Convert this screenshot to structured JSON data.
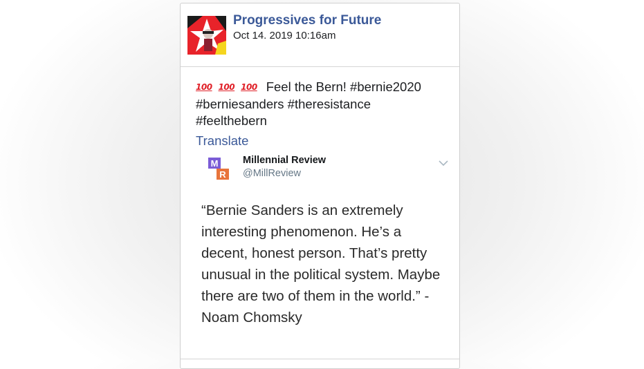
{
  "post": {
    "page_name": "Progressives for Future",
    "timestamp": "Oct 14. 2019 10:16am",
    "emoji_glyph": "100",
    "emoji_icon": "hundred-points-emoji",
    "text_line1": "Feel the Bern! #bernie2020",
    "text_line2": "#berniesanders #theresistance",
    "text_line3": "#feelthebern",
    "translate_label": "Translate"
  },
  "embedded_tweet": {
    "author": "Millennial Review",
    "handle": "@MillReview",
    "logo_letters": [
      "M",
      "R"
    ],
    "quote": "“Bernie Sanders is an extremely interesting phenomenon. He’s a decent, honest person. That’s pretty unusual in the political system. Maybe there are two of them in the world.” - Noam Chomsky"
  },
  "colors": {
    "link_blue": "#3b5998",
    "logo_purple": "#7b5cd6",
    "logo_orange": "#e8743b",
    "emoji_red": "#e02028"
  }
}
